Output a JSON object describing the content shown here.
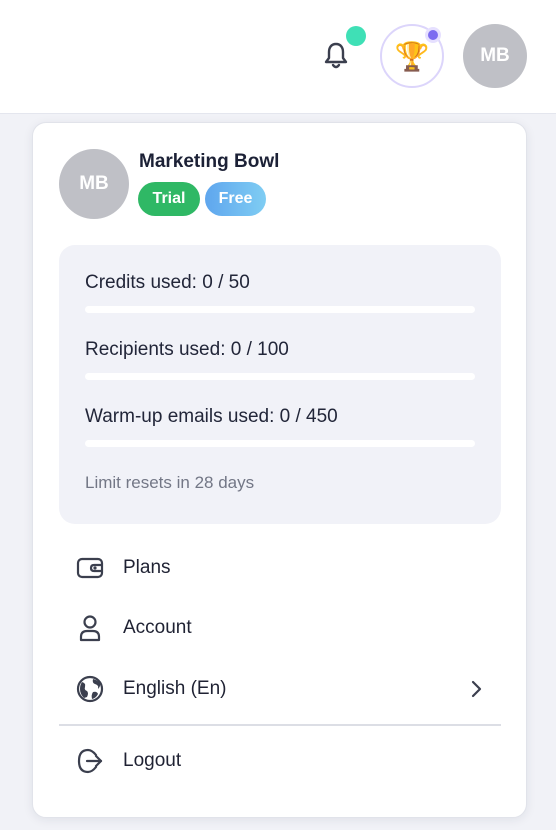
{
  "header": {
    "avatar_initials": "MB",
    "icons": [
      "bell-icon",
      "trophy-icon"
    ],
    "notification_dot_color": "#3fe0b6",
    "achievement_dot_color": "#7d6cf0"
  },
  "profile": {
    "initials": "MB",
    "name": "Marketing Bowl",
    "badges": [
      {
        "label": "Trial",
        "color": "#2fb865"
      },
      {
        "label": "Free",
        "color": "#6bb6f1"
      }
    ]
  },
  "usage": {
    "items": [
      {
        "label": "Credits used: 0 / 50",
        "used": 0,
        "limit": 50
      },
      {
        "label": "Recipients used: 0 / 100",
        "used": 0,
        "limit": 100
      },
      {
        "label": "Warm-up emails used: 0 / 450",
        "used": 0,
        "limit": 450
      }
    ],
    "reset_text": "Limit resets in 28 days"
  },
  "menu": {
    "items": [
      {
        "label": "Plans",
        "icon": "wallet-icon"
      },
      {
        "label": "Account",
        "icon": "user-icon"
      },
      {
        "label": "English (En)",
        "icon": "globe-icon",
        "has_submenu": true
      },
      {
        "label": "Logout",
        "icon": "logout-icon"
      }
    ]
  },
  "colors": {
    "accent": "#6b5ce7",
    "avatar_bg": "#bfc0c6"
  }
}
